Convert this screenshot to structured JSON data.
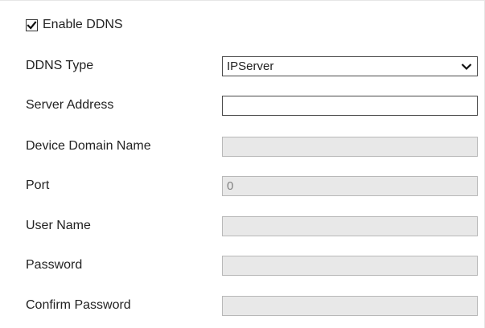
{
  "enable": {
    "label": "Enable DDNS",
    "checked": true,
    "icon": "check-icon"
  },
  "form": {
    "ddns_type": {
      "label": "DDNS Type",
      "value": "IPServer",
      "icon": "chevron-down-icon"
    },
    "server_address": {
      "label": "Server Address",
      "value": ""
    },
    "device_domain_name": {
      "label": "Device Domain Name",
      "value": ""
    },
    "port": {
      "label": "Port",
      "value": "0"
    },
    "user_name": {
      "label": "User Name",
      "value": ""
    },
    "password": {
      "label": "Password",
      "value": ""
    },
    "confirm_password": {
      "label": "Confirm Password",
      "value": ""
    }
  }
}
